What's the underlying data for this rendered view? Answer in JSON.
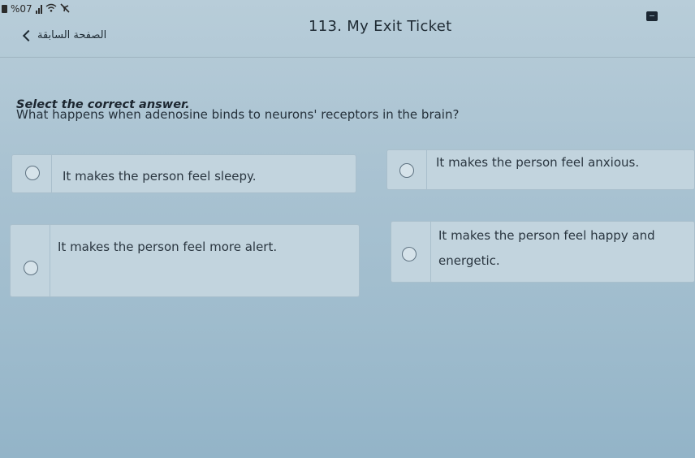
{
  "status_bar": {
    "battery_text": "%07",
    "icons": [
      "battery-icon",
      "signal-icon",
      "wifi-icon",
      "airplane-icon"
    ]
  },
  "header": {
    "back_label": "الصفحة السابقة",
    "title": "113. My Exit Ticket"
  },
  "question": {
    "instruction": "Select the correct answer.",
    "text": "What happens when adenosine binds to neurons' receptors in the brain?"
  },
  "options": [
    {
      "label": "It makes the person feel sleepy."
    },
    {
      "label": "It makes the person feel anxious."
    },
    {
      "label": "It makes the person feel more alert."
    },
    {
      "label": "It makes the person feel happy and energetic."
    }
  ],
  "colors": {
    "background": "#a9c2d1",
    "option_background": "#c2d4de",
    "text": "#2a3640"
  }
}
